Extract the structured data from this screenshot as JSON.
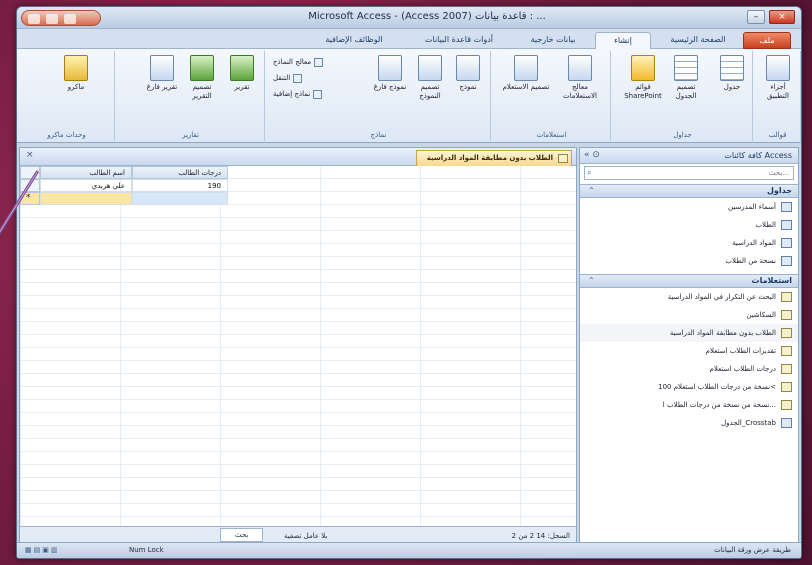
{
  "window": {
    "title": "Microsoft Access - (Access 2007) قاعدة بيانات : ..."
  },
  "tabs": [
    "ملف",
    "الصفحة الرئيسية",
    "إنشاء",
    "بيانات خارجية",
    "أدوات قاعدة البيانات",
    "الوظائف الإضافية"
  ],
  "ribbon": {
    "groups": [
      {
        "name": "قوالب",
        "buttons": [
          "أجزاء التطبيق"
        ]
      },
      {
        "name": "جداول",
        "buttons": [
          "جدول",
          "تصميم الجدول",
          "قوائم SharePoint"
        ]
      },
      {
        "name": "استعلامات",
        "buttons": [
          "معالج الاستعلامات",
          "تصميم الاستعلام"
        ]
      },
      {
        "name": "نماذج",
        "buttons": [
          "نموذج",
          "تصميم النموذج",
          "نموذج فارغ"
        ],
        "small": [
          "معالج النماذج",
          "التنقل",
          "نماذج إضافية"
        ]
      },
      {
        "name": "تقارير",
        "buttons": [
          "تقرير",
          "تصميم التقرير",
          "تقرير فارغ"
        ]
      },
      {
        "name": "وحدات ماكرو",
        "buttons": [
          "ماكرو"
        ]
      }
    ]
  },
  "nav": {
    "title": "كافة كائنات Access",
    "search_placeholder": "بحث...",
    "tables_label": "جداول",
    "tables": [
      "أسماء المدرسين",
      "الطلاب",
      "المواد الدراسية",
      "نسخة من الطلاب"
    ],
    "queries_label": "استعلامات",
    "queries": [
      "البحث عن التكرار في المواد الدراسية",
      "السكاشين",
      "الطلاب بدون مطابقة المواد الدراسية",
      "تقديرات الطلاب استعلام",
      "درجات الطلاب استعلام",
      "نسخة من درجات الطلاب استعلام 100<",
      "نسخة من نسخة من درجات الطلاب ا...",
      "الجدول_Crosstab"
    ]
  },
  "document": {
    "tab_label": "الطلاب بدون مطابقة المواد الدراسية",
    "columns": [
      "اسم الطالب",
      "درجات الطالب"
    ],
    "rows": [
      [
        "علي هريدي",
        "190"
      ]
    ],
    "record_nav": "السجل: 14 2 من 2",
    "filter": "بلا عامل تصفية",
    "search": "بحث"
  },
  "status": {
    "left": "طريقة عرض ورقة البيانات",
    "num_lock": "Num Lock"
  }
}
